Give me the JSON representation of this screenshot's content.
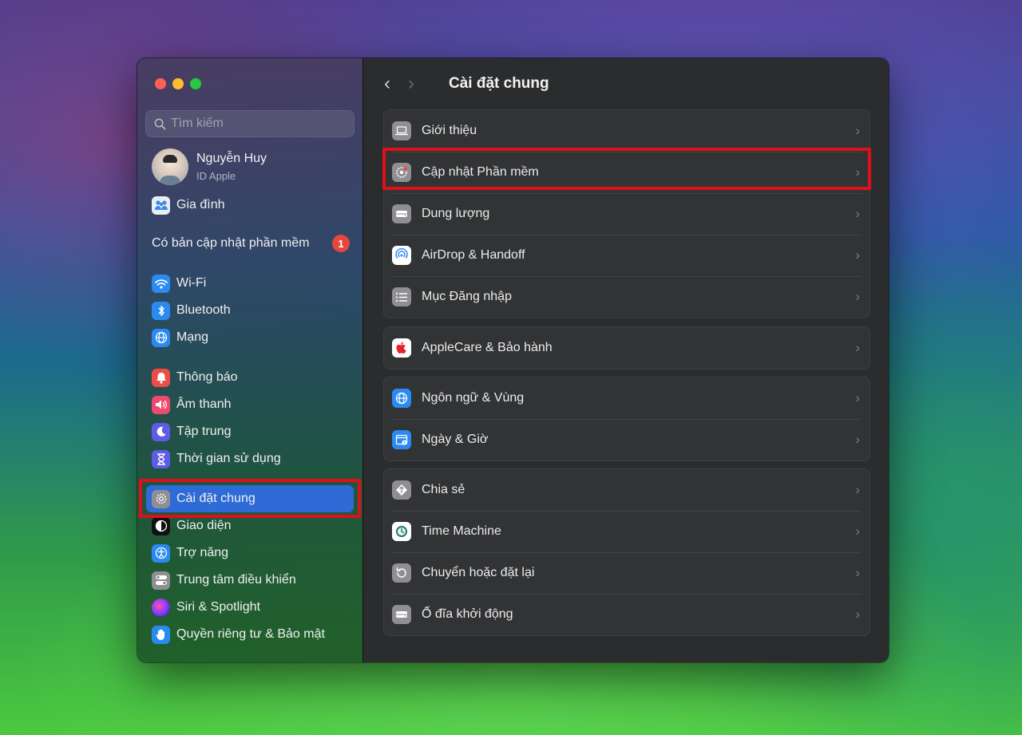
{
  "window": {
    "title": "Cài đặt chung"
  },
  "colors": {
    "accent": "#2f6bd6",
    "highlight": "#e0101b",
    "badge": "#e5473c"
  },
  "sidebar": {
    "search_placeholder": "Tìm kiếm",
    "profile": {
      "name": "Nguyễn Huy",
      "subtitle": "ID Apple"
    },
    "family": "Gia đình",
    "update_notice": {
      "label": "Có bản cập nhật phần mềm",
      "count": "1"
    },
    "items": [
      {
        "label": "Wi-Fi",
        "icon": "wifi-icon"
      },
      {
        "label": "Bluetooth",
        "icon": "bluetooth-icon"
      },
      {
        "label": "Mạng",
        "icon": "globe-icon"
      },
      {
        "label": "Thông báo",
        "icon": "bell-icon"
      },
      {
        "label": "Âm thanh",
        "icon": "speaker-icon"
      },
      {
        "label": "Tập trung",
        "icon": "moon-icon"
      },
      {
        "label": "Thời gian sử dụng",
        "icon": "hourglass-icon"
      },
      {
        "label": "Cài đặt chung",
        "icon": "gear-icon",
        "selected": true
      },
      {
        "label": "Giao diện",
        "icon": "appearance-icon"
      },
      {
        "label": "Trợ năng",
        "icon": "accessibility-icon"
      },
      {
        "label": "Trung tâm điều khiển",
        "icon": "toggles-icon"
      },
      {
        "label": "Siri & Spotlight",
        "icon": "siri-icon"
      },
      {
        "label": "Quyền riêng tư & Bảo mật",
        "icon": "hand-icon"
      }
    ]
  },
  "main": {
    "title": "Cài đặt chung",
    "groups": [
      {
        "rows": [
          {
            "label": "Giới thiệu",
            "icon": "laptop-icon"
          },
          {
            "label": "Cập nhật Phần mềm",
            "icon": "software-update-icon"
          },
          {
            "label": "Dung lượng",
            "icon": "storage-icon"
          },
          {
            "label": "AirDrop & Handoff",
            "icon": "airdrop-icon"
          },
          {
            "label": "Mục Đăng nhập",
            "icon": "list-icon"
          }
        ]
      },
      {
        "rows": [
          {
            "label": "AppleCare & Bảo hành",
            "icon": "apple-icon"
          }
        ]
      },
      {
        "rows": [
          {
            "label": "Ngôn ngữ & Vùng",
            "icon": "globe-icon"
          },
          {
            "label": "Ngày & Giờ",
            "icon": "calendar-icon"
          }
        ]
      },
      {
        "rows": [
          {
            "label": "Chia sẻ",
            "icon": "share-icon"
          },
          {
            "label": "Time Machine",
            "icon": "time-machine-icon"
          },
          {
            "label": "Chuyển hoặc đặt lại",
            "icon": "reset-icon"
          },
          {
            "label": "Ổ đĩa khởi động",
            "icon": "disk-icon"
          }
        ]
      }
    ]
  }
}
